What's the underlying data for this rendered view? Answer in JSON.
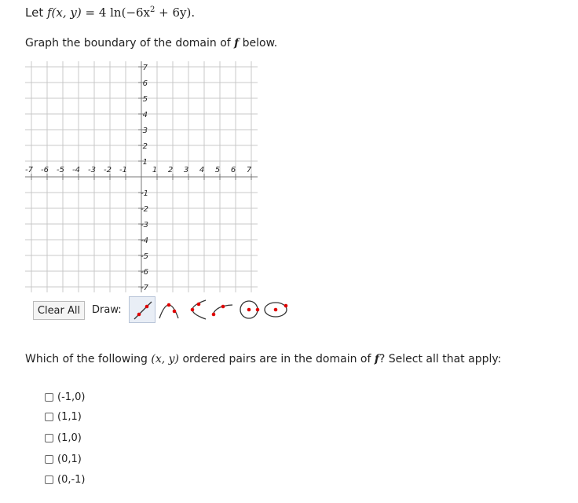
{
  "question": {
    "prefix": "Let ",
    "func_lhs": "f(x, y) = ",
    "func_rhs": "4 ln(−6x",
    "func_exp": "2",
    "func_tail": " + 6y).",
    "instruction_pre": "Graph the boundary of the domain of ",
    "instruction_f": "f",
    "instruction_post": " below."
  },
  "graph": {
    "x_ticks": [
      "-7",
      "-6",
      "-5",
      "-4",
      "-3",
      "-2",
      "-1",
      "1",
      "2",
      "3",
      "4",
      "5",
      "6",
      "7"
    ],
    "y_ticks_pos": [
      "1",
      "2",
      "3",
      "4",
      "5",
      "6",
      "7"
    ],
    "y_ticks_neg": [
      "-1",
      "-2",
      "-3",
      "-4",
      "-5",
      "-6",
      "-7"
    ]
  },
  "toolbar": {
    "clear_label": "Clear All",
    "draw_label": "Draw:",
    "tools": [
      "line-icon",
      "parabola-icon",
      "horizontal-parabola-icon",
      "sqrt-curve-icon",
      "circle-icon",
      "ellipse-icon"
    ],
    "selected_tool": "line-icon",
    "dot_color": "#e00000"
  },
  "domain_question": {
    "pre": "Which of the following ",
    "pair": "(x, y)",
    "mid": " ordered pairs are in the domain of ",
    "f": "f",
    "post": "? Select all that apply:"
  },
  "options": [
    {
      "label": "(-1,0)",
      "checked": false
    },
    {
      "label": "(1,1)",
      "checked": false
    },
    {
      "label": "(1,0)",
      "checked": false
    },
    {
      "label": "(0,1)",
      "checked": false
    },
    {
      "label": "(0,-1)",
      "checked": false
    }
  ]
}
